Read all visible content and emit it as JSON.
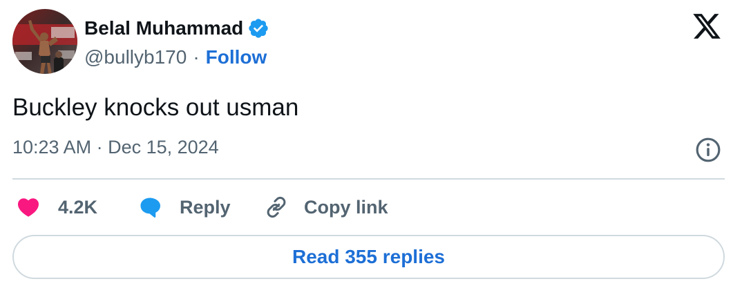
{
  "author": {
    "display_name": "Belal Muhammad",
    "handle": "@bullyb170",
    "separator": "·",
    "follow_label": "Follow",
    "verified": true,
    "avatar": "avatar-photo"
  },
  "tweet": {
    "text": "Buckley knocks out usman",
    "timestamp": "10:23 AM · Dec 15, 2024"
  },
  "actions": {
    "like_count": "4.2K",
    "reply_label": "Reply",
    "copy_link_label": "Copy link"
  },
  "read_replies_label": "Read 355 replies",
  "icons": {
    "brand": "x-logo-icon",
    "verified": "verified-badge-icon",
    "info": "info-icon",
    "like": "heart-icon",
    "reply": "speech-bubble-icon",
    "copy": "link-icon"
  },
  "colors": {
    "link_blue": "#1d6fd6",
    "verified_blue": "#1d9bf0",
    "heart_pink": "#f91880",
    "secondary_text": "#536471",
    "divider": "#cfd9de"
  }
}
